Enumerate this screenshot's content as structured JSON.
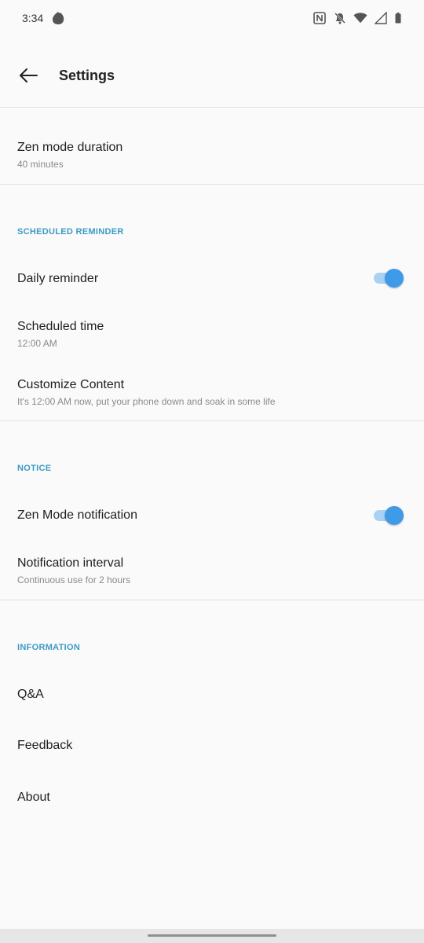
{
  "status_bar": {
    "time": "3:34",
    "icons": [
      "app-notification-icon",
      "nfc-icon",
      "bell-muted-icon",
      "wifi-icon",
      "signal-icon",
      "battery-icon"
    ]
  },
  "app_bar": {
    "title": "Settings",
    "back_icon": "arrow-left-icon"
  },
  "settings": {
    "zen_duration": {
      "title": "Zen mode duration",
      "value": "40 minutes"
    },
    "scheduled_reminder": {
      "header": "SCHEDULED REMINDER",
      "daily_reminder": {
        "title": "Daily reminder",
        "enabled": true
      },
      "scheduled_time": {
        "title": "Scheduled time",
        "value": "12:00 AM"
      },
      "customize_content": {
        "title": "Customize Content",
        "value": "It's 12:00 AM now, put your phone down and soak in some life"
      }
    },
    "notice": {
      "header": "NOTICE",
      "zen_notification": {
        "title": "Zen Mode notification",
        "enabled": true
      },
      "notification_interval": {
        "title": "Notification interval",
        "value": "Continuous use for 2 hours"
      }
    },
    "information": {
      "header": "INFORMATION",
      "qa": "Q&A",
      "feedback": "Feedback",
      "about": "About"
    }
  },
  "colors": {
    "accent": "#3f9ae8",
    "section_header": "#3c9bc4",
    "background": "#fafafa"
  }
}
